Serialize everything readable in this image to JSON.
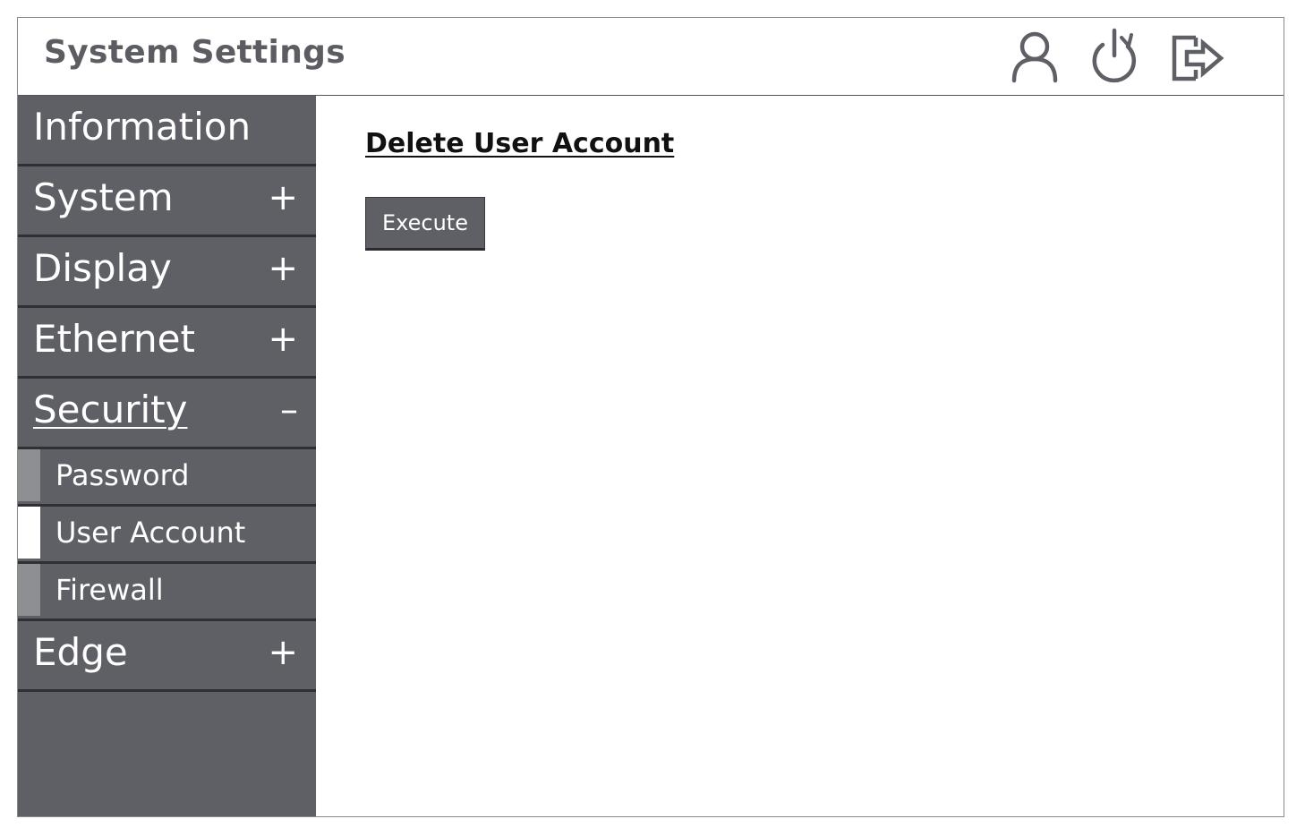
{
  "header": {
    "title": "System Settings",
    "icons": [
      "user-icon",
      "restart-icon",
      "logout-icon"
    ],
    "icon_color": "#5f6065"
  },
  "sidebar": {
    "items": [
      {
        "label": "Information",
        "toggle": ""
      },
      {
        "label": "System",
        "toggle": "+"
      },
      {
        "label": "Display",
        "toggle": "+"
      },
      {
        "label": "Ethernet",
        "toggle": "+"
      },
      {
        "label": "Security",
        "toggle": "–",
        "expanded": true
      },
      {
        "label": "Edge",
        "toggle": "+"
      }
    ],
    "security_subitems": [
      {
        "label": "Password",
        "selected": false
      },
      {
        "label": "User Account",
        "selected": true
      },
      {
        "label": "Firewall",
        "selected": false
      }
    ],
    "colors": {
      "background": "#5f6065",
      "separator": "#2f3034",
      "marker": "#8e8f93",
      "selected_marker": "#ffffff"
    }
  },
  "main": {
    "section_title": "Delete User Account",
    "execute_label": "Execute"
  }
}
